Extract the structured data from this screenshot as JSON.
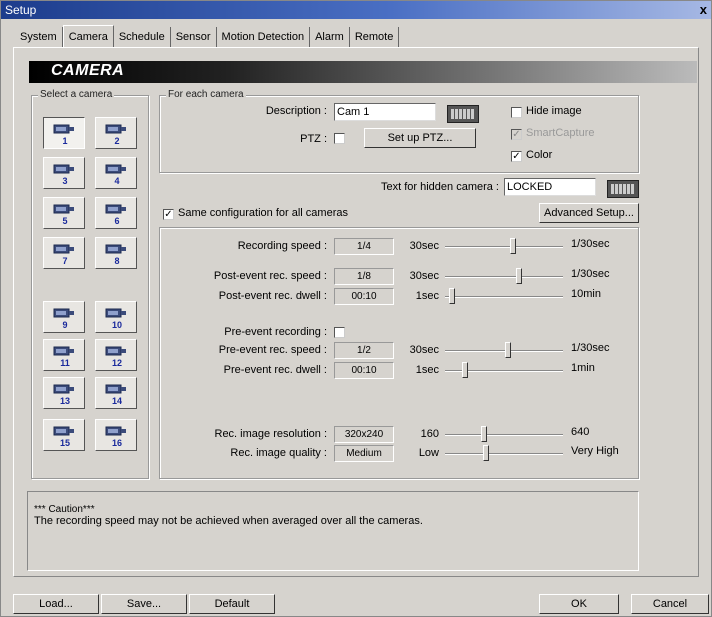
{
  "window": {
    "title": "Setup",
    "close": "x"
  },
  "tabs": [
    "System",
    "Camera",
    "Schedule",
    "Sensor",
    "Motion Detection",
    "Alarm",
    "Remote"
  ],
  "banner": {
    "title": "CAMERA"
  },
  "select_camera": {
    "title": "Select a camera",
    "cameras": [
      "1",
      "2",
      "3",
      "4",
      "5",
      "6",
      "7",
      "8",
      "9",
      "10",
      "11",
      "12",
      "13",
      "14",
      "15",
      "16"
    ]
  },
  "each_camera": {
    "title": "For each camera",
    "description_label": "Description :",
    "description_value": "Cam 1",
    "ptz_label": "PTZ :",
    "setup_ptz": "Set up PTZ...",
    "hide_image": "Hide image",
    "smart_capture": "SmartCapture",
    "color": "Color"
  },
  "hidden_text": {
    "label": "Text for hidden camera :",
    "value": "LOCKED"
  },
  "same_config": "Same configuration for all cameras",
  "advanced_setup": "Advanced Setup...",
  "settings": {
    "rec_speed": {
      "label": "Recording speed :",
      "value": "1/4",
      "min": "30sec",
      "max": "1/30sec",
      "level": 0.58
    },
    "post_speed": {
      "label": "Post-event rec. speed :",
      "value": "1/8",
      "min": "30sec",
      "max": "1/30sec",
      "level": 0.63
    },
    "post_dwell": {
      "label": "Post-event rec. dwell :",
      "value": "00:10",
      "min": "1sec",
      "max": "10min",
      "level": 0.06
    },
    "pre_recording": {
      "label": "Pre-event recording :"
    },
    "pre_speed": {
      "label": "Pre-event rec. speed :",
      "value": "1/2",
      "min": "30sec",
      "max": "1/30sec",
      "level": 0.53
    },
    "pre_dwell": {
      "label": "Pre-event rec. dwell :",
      "value": "00:10",
      "min": "1sec",
      "max": "1min",
      "level": 0.17
    },
    "resolution": {
      "label": "Rec. image resolution :",
      "value": "320x240",
      "min": "160",
      "max": "640",
      "level": 0.33
    },
    "quality": {
      "label": "Rec. image quality :",
      "value": "Medium",
      "min": "Low",
      "max": "Very High",
      "level": 0.35
    }
  },
  "caution": {
    "title": "*** Caution***",
    "text": "The recording speed may not be achieved when averaged over all the cameras."
  },
  "footer": {
    "load": "Load...",
    "save": "Save...",
    "default": "Default",
    "ok": "OK",
    "cancel": "Cancel"
  }
}
